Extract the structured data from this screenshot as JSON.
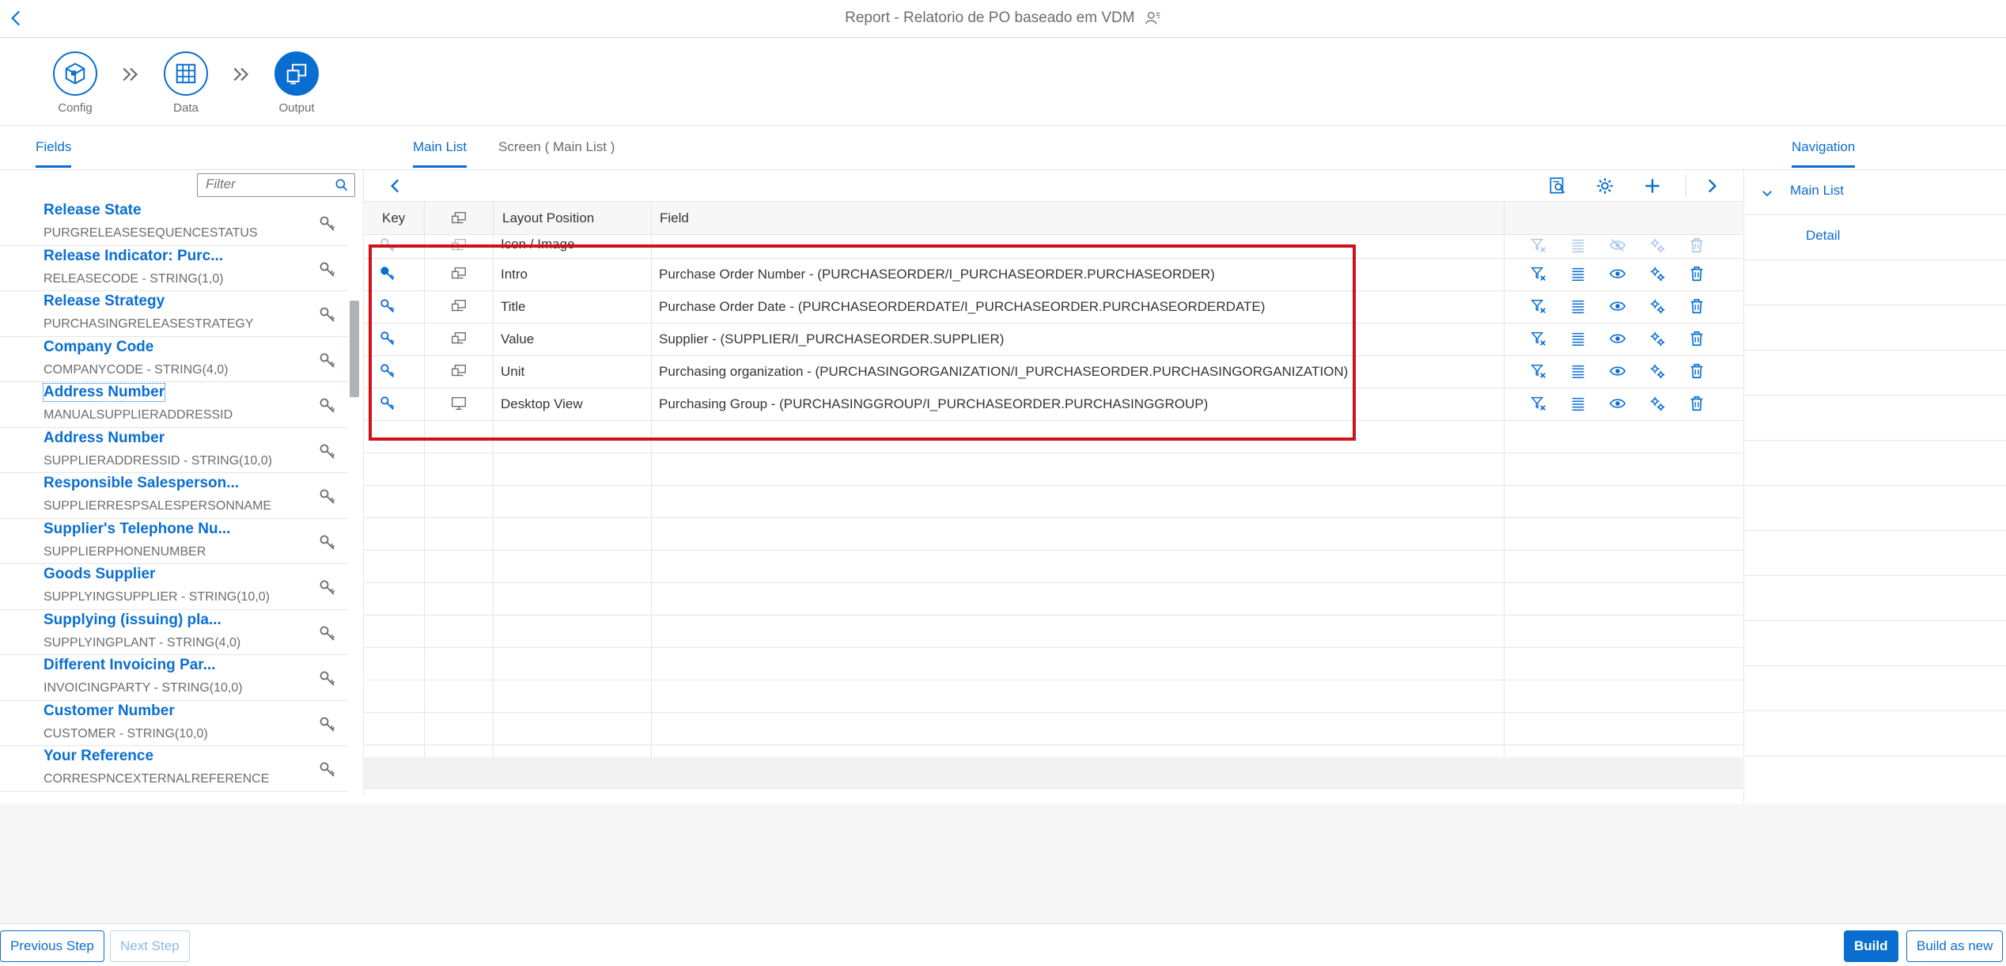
{
  "shell": {
    "title": "Report - Relatorio de PO baseado em VDM"
  },
  "wizard": {
    "steps": [
      {
        "label": "Config"
      },
      {
        "label": "Data"
      },
      {
        "label": "Output"
      }
    ]
  },
  "tabs": {
    "fields": "Fields",
    "main_list": "Main List",
    "screen": "Screen ( Main List )",
    "navigation": "Navigation"
  },
  "filter": {
    "placeholder": "Filter"
  },
  "fields": [
    {
      "name": "Release State",
      "tech": "PURGRELEASESEQUENCESTATUS"
    },
    {
      "name": "Release Indicator: Purc...",
      "tech": "RELEASECODE - STRING(1,0)"
    },
    {
      "name": "Release Strategy",
      "tech": "PURCHASINGRELEASESTRATEGY"
    },
    {
      "name": "Company Code",
      "tech": "COMPANYCODE - STRING(4,0)"
    },
    {
      "name": "Address Number",
      "tech": "MANUALSUPPLIERADDRESSID"
    },
    {
      "name": "Address Number",
      "tech": "SUPPLIERADDRESSID - STRING(10,0)"
    },
    {
      "name": "Responsible Salesperson...",
      "tech": "SUPPLIERRESPSALESPERSONNAME"
    },
    {
      "name": "Supplier's Telephone Nu...",
      "tech": "SUPPLIERPHONENUMBER"
    },
    {
      "name": "Goods Supplier",
      "tech": "SUPPLYINGSUPPLIER - STRING(10,0)"
    },
    {
      "name": "Supplying (issuing) pla...",
      "tech": "SUPPLYINGPLANT - STRING(4,0)"
    },
    {
      "name": "Different Invoicing Par...",
      "tech": "INVOICINGPARTY - STRING(10,0)"
    },
    {
      "name": "Customer Number",
      "tech": "CUSTOMER - STRING(10,0)"
    },
    {
      "name": "Your Reference",
      "tech": "CORRESPNCEXTERNALREFERENCE"
    }
  ],
  "table": {
    "headers": {
      "key": "Key",
      "layout_position": "Layout Position",
      "field": "Field"
    },
    "rows": [
      {
        "position": "Icon / Image",
        "field": ""
      },
      {
        "position": "Intro",
        "field": "Purchase Order Number - (PURCHASEORDER/I_PURCHASEORDER.PURCHASEORDER)"
      },
      {
        "position": "Title",
        "field": "Purchase Order Date - (PURCHASEORDERDATE/I_PURCHASEORDER.PURCHASEORDERDATE)"
      },
      {
        "position": "Value",
        "field": "Supplier - (SUPPLIER/I_PURCHASEORDER.SUPPLIER)"
      },
      {
        "position": "Unit",
        "field": "Purchasing organization - (PURCHASINGORGANIZATION/I_PURCHASEORDER.PURCHASINGORGANIZATION)"
      },
      {
        "position": "Desktop View",
        "field": "Purchasing Group - (PURCHASINGGROUP/I_PURCHASEORDER.PURCHASINGGROUP)"
      }
    ]
  },
  "navigation": {
    "items": [
      {
        "label": "Main List"
      },
      {
        "label": "Detail"
      }
    ]
  },
  "footer": {
    "previous": "Previous Step",
    "next": "Next Step",
    "build": "Build",
    "build_as_new": "Build as new"
  },
  "colors": {
    "accent": "#0a6ed1",
    "highlight": "#d0101a"
  }
}
